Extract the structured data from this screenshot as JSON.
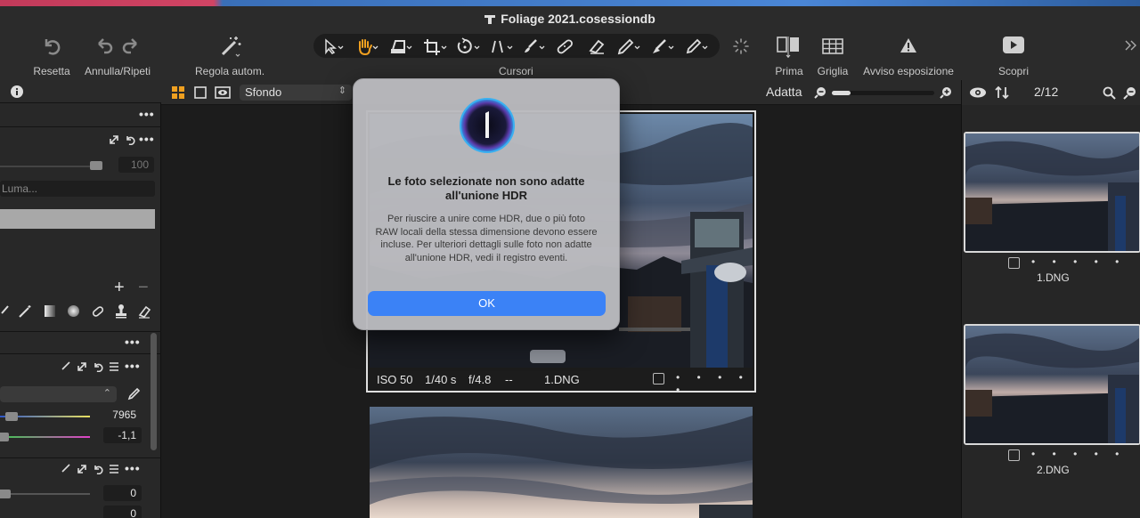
{
  "window": {
    "title": "Foliage 2021.cosessiondb"
  },
  "toolbar": {
    "reset_label": "Resetta",
    "undo_redo_label": "Annulla/Ripeti",
    "auto_adjust_label": "Regola autom.",
    "cursors_label": "Cursori",
    "before_label": "Prima",
    "grid_label": "Griglia",
    "exposure_warning_label": "Avviso esposizione",
    "discover_label": "Scopri"
  },
  "left_panel": {
    "slider1_value": "100",
    "luma_placeholder": "Luma...",
    "wb_value1": "7965",
    "wb_value2": "-1,1",
    "value_a": "0",
    "value_b": "0"
  },
  "viewer": {
    "background_select": "Sfondo",
    "fit_label": "Adatta",
    "zoom_fraction": 0.18,
    "photo": {
      "iso": "ISO 50",
      "shutter": "1/40 s",
      "aperture": "f/4.8",
      "extra": "--",
      "filename": "1.DNG"
    }
  },
  "browser": {
    "counter": "2/12",
    "thumbs": [
      {
        "name": "1.DNG"
      },
      {
        "name": "2.DNG"
      }
    ]
  },
  "dialog": {
    "title": "Le foto selezionate non sono adatte all'unione HDR",
    "body": "Per riuscire a unire come HDR, due o più foto RAW locali della stessa dimensione devono essere incluse. Per ulteriori dettagli sulle foto non adatte all'unione HDR, vedi il registro eventi.",
    "ok_label": "OK"
  },
  "colors": {
    "accent_blue": "#3b82f6",
    "grid_orange": "#f0a020",
    "hand_orange": "#f0a020"
  },
  "icons": [
    "reset-icon",
    "undo-icon",
    "redo-icon",
    "magic-wand-icon",
    "select-cursor-icon",
    "hand-icon",
    "straighten-icon",
    "crop-icon",
    "rotate-icon",
    "keystone-icon",
    "brush-icon",
    "heal-icon",
    "eraser-icon",
    "picker-icon",
    "gradient-icon",
    "annotate-icon",
    "spinner-icon",
    "before-icon",
    "grid-icon",
    "warning-icon",
    "play-icon",
    "chevron-right-icon",
    "info-icon",
    "eye-icon",
    "sort-icon",
    "search-icon",
    "zoom-icon"
  ]
}
